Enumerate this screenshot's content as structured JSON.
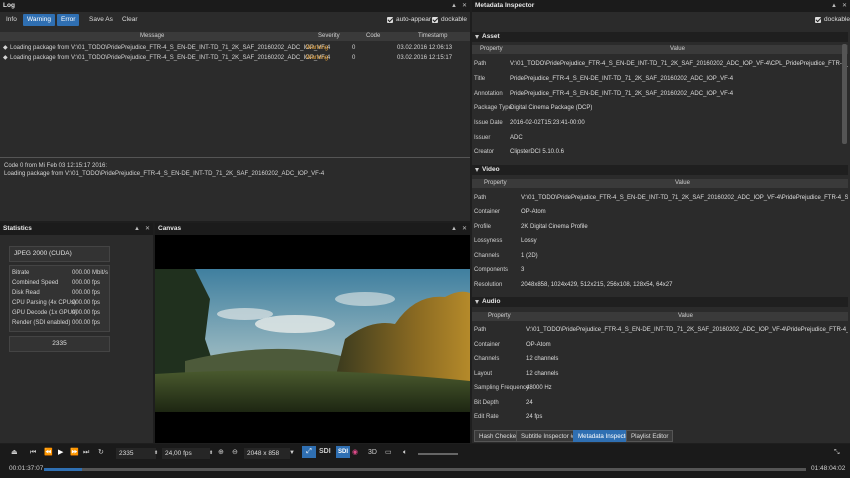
{
  "log": {
    "title": "Log",
    "btn_info": "Info",
    "btn_warning": "Warning",
    "btn_error": "Error",
    "btn_save": "Save As",
    "btn_clear": "Clear",
    "auto_appear": "auto-appear",
    "dockable": "dockable",
    "columns": [
      "Message",
      "Severity",
      "Code",
      "Timestamp"
    ],
    "rows": [
      {
        "message": "Loading package from V:\\01_TODO\\PridePrejudice_FTR-4_S_EN-DE_INT-TD_71_2K_SAF_20160202_ADC_IOP_VF-4",
        "severity": "Warning",
        "code": "0",
        "timestamp": "03.02.2016 12:06:13"
      },
      {
        "message": "Loading package from V:\\01_TODO\\PridePrejudice_FTR-4_S_EN-DE_INT-TD_71_2K_SAF_20160202_ADC_IOP_VF-4",
        "severity": "Warning",
        "code": "0",
        "timestamp": "03.02.2016 12:15:17"
      }
    ],
    "detail_line1": "Code 0 from Mi Feb 03 12:15:17 2016:",
    "detail_line2": "Loading package from V:\\01_TODO\\PridePrejudice_FTR-4_S_EN-DE_INT-TD_71_2K_SAF_20160202_ADC_IOP_VF-4"
  },
  "stats": {
    "title": "Statistics",
    "decoder": "JPEG 2000 (CUDA)",
    "rows": [
      {
        "k": "Bitrate",
        "v": "000.00 Mbit/s"
      },
      {
        "k": "Combined Speed",
        "v": "000.00 fps"
      },
      {
        "k": "Disk Read",
        "v": "000.00 fps"
      },
      {
        "k": "CPU Parsing (4x CPUs)",
        "v": "000.00 fps"
      },
      {
        "k": "GPU Decode (1x GPUs)",
        "v": "000.00 fps"
      },
      {
        "k": "Render (SDI enabled)",
        "v": "000.00 fps"
      }
    ],
    "frame": "2335"
  },
  "canvas": {
    "title": "Canvas"
  },
  "meta": {
    "title": "Metadata Inspector",
    "dockable": "dockable",
    "asset_title": "Asset",
    "video_title": "Video",
    "audio_title": "Audio",
    "col_property": "Property",
    "col_value": "Value",
    "asset": [
      {
        "k": "Path",
        "v": "V:\\01_TODO\\PridePrejudice_FTR-4_S_EN-DE_INT-TD_71_2K_SAF_20160202_ADC_IOP_VF-4\\CPL_PridePrejudice_FTR-4_S_EN-DE"
      },
      {
        "k": "Title",
        "v": "PridePrejudice_FTR-4_S_EN-DE_INT-TD_71_2K_SAF_20160202_ADC_IOP_VF-4"
      },
      {
        "k": "Annotation",
        "v": "PridePrejudice_FTR-4_S_EN-DE_INT-TD_71_2K_SAF_20160202_ADC_IOP_VF-4"
      },
      {
        "k": "Package Type",
        "v": "Digital Cinema Package (DCP)"
      },
      {
        "k": "Issue Date",
        "v": "2016-02-02T15:23:41-00:00"
      },
      {
        "k": "Issuer",
        "v": "ADC"
      },
      {
        "k": "Creator",
        "v": "ClipsterDCI 5.10.0.6"
      }
    ],
    "video": [
      {
        "k": "Path",
        "v": "V:\\01_TODO\\PridePrejudice_FTR-4_S_EN-DE_INT-TD_71_2K_SAF_20160202_ADC_IOP_VF-4\\PridePrejudice_FTR-4_S_EN-DE"
      },
      {
        "k": "Container",
        "v": "OP-Atom"
      },
      {
        "k": "Profile",
        "v": "2K Digital Cinema Profile"
      },
      {
        "k": "Lossyness",
        "v": "Lossy"
      },
      {
        "k": "Channels",
        "v": "1 (2D)"
      },
      {
        "k": "Components",
        "v": "3"
      },
      {
        "k": "Resolution",
        "v": "2048x858, 1024x429, 512x215, 256x108, 128x54, 64x27"
      }
    ],
    "audio": [
      {
        "k": "Path",
        "v": "V:\\01_TODO\\PridePrejudice_FTR-4_S_EN-DE_INT-TD_71_2K_SAF_20160202_ADC_IOP_VF-4\\PridePrejudice_FTR-4_S_EN-DE"
      },
      {
        "k": "Container",
        "v": "OP-Atom"
      },
      {
        "k": "Channels",
        "v": "12 channels"
      },
      {
        "k": "Layout",
        "v": "12 channels"
      },
      {
        "k": "Sampling Frequency",
        "v": "48000 Hz"
      },
      {
        "k": "Bit Depth",
        "v": "24"
      },
      {
        "k": "Edit Rate",
        "v": "24 fps"
      }
    ],
    "tabs": [
      "Hash Checker",
      "Subtitle Inspector #1",
      "Metadata Inspector",
      "Playlist Editor"
    ]
  },
  "toolbar": {
    "frame": "2335",
    "fps": "24,00 fps",
    "resolution": "2048 x 858",
    "sdi": "SDI",
    "three_d": "3D",
    "time_start": "00:01:37:07",
    "time_end": "01:48:04:02",
    "progress": 0.05
  }
}
